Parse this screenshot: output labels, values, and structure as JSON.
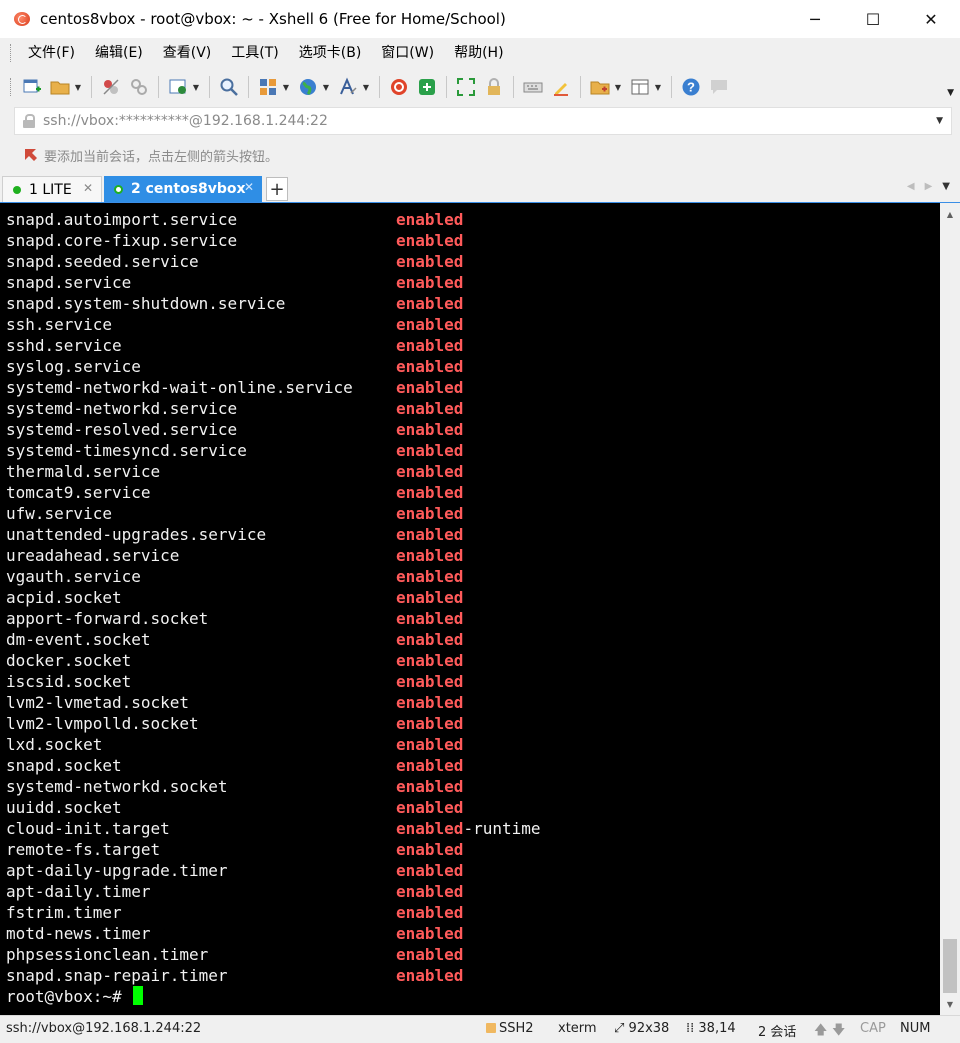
{
  "window": {
    "title": "centos8vbox - root@vbox: ~ - Xshell 6 (Free for Home/School)",
    "controls": {
      "minimize": "─",
      "maximize": "☐",
      "close": "✕"
    }
  },
  "menu": [
    "文件(F)",
    "编辑(E)",
    "查看(V)",
    "工具(T)",
    "选项卡(B)",
    "窗口(W)",
    "帮助(H)"
  ],
  "address": {
    "text": "ssh://vbox:**********@192.168.1.244:22"
  },
  "hint": {
    "text": "要添加当前会话，点击左侧的箭头按钮。"
  },
  "tabs": [
    {
      "label": "1 LITE",
      "active": false
    },
    {
      "label": "2 centos8vbox",
      "active": true
    }
  ],
  "terminal": {
    "lines": [
      {
        "unit": "snapd.autoimport.service",
        "state": "enabled"
      },
      {
        "unit": "snapd.core-fixup.service",
        "state": "enabled"
      },
      {
        "unit": "snapd.seeded.service",
        "state": "enabled"
      },
      {
        "unit": "snapd.service",
        "state": "enabled"
      },
      {
        "unit": "snapd.system-shutdown.service",
        "state": "enabled"
      },
      {
        "unit": "ssh.service",
        "state": "enabled"
      },
      {
        "unit": "sshd.service",
        "state": "enabled"
      },
      {
        "unit": "syslog.service",
        "state": "enabled"
      },
      {
        "unit": "systemd-networkd-wait-online.service",
        "state": "enabled"
      },
      {
        "unit": "systemd-networkd.service",
        "state": "enabled"
      },
      {
        "unit": "systemd-resolved.service",
        "state": "enabled"
      },
      {
        "unit": "systemd-timesyncd.service",
        "state": "enabled"
      },
      {
        "unit": "thermald.service",
        "state": "enabled"
      },
      {
        "unit": "tomcat9.service",
        "state": "enabled"
      },
      {
        "unit": "ufw.service",
        "state": "enabled"
      },
      {
        "unit": "unattended-upgrades.service",
        "state": "enabled"
      },
      {
        "unit": "ureadahead.service",
        "state": "enabled"
      },
      {
        "unit": "vgauth.service",
        "state": "enabled"
      },
      {
        "unit": "acpid.socket",
        "state": "enabled"
      },
      {
        "unit": "apport-forward.socket",
        "state": "enabled"
      },
      {
        "unit": "dm-event.socket",
        "state": "enabled"
      },
      {
        "unit": "docker.socket",
        "state": "enabled"
      },
      {
        "unit": "iscsid.socket",
        "state": "enabled"
      },
      {
        "unit": "lvm2-lvmetad.socket",
        "state": "enabled"
      },
      {
        "unit": "lvm2-lvmpolld.socket",
        "state": "enabled"
      },
      {
        "unit": "lxd.socket",
        "state": "enabled"
      },
      {
        "unit": "snapd.socket",
        "state": "enabled"
      },
      {
        "unit": "systemd-networkd.socket",
        "state": "enabled"
      },
      {
        "unit": "uuidd.socket",
        "state": "enabled"
      },
      {
        "unit": "cloud-init.target",
        "state": "enabled",
        "suffix": "-runtime"
      },
      {
        "unit": "remote-fs.target",
        "state": "enabled"
      },
      {
        "unit": "apt-daily-upgrade.timer",
        "state": "enabled"
      },
      {
        "unit": "apt-daily.timer",
        "state": "enabled"
      },
      {
        "unit": "fstrim.timer",
        "state": "enabled"
      },
      {
        "unit": "motd-news.timer",
        "state": "enabled"
      },
      {
        "unit": "phpsessionclean.timer",
        "state": "enabled"
      },
      {
        "unit": "snapd.snap-repair.timer",
        "state": "enabled"
      }
    ],
    "prompt": "root@vbox:~# "
  },
  "status": {
    "connection": "ssh://vbox@192.168.1.244:22",
    "protocol": "SSH2",
    "terminal_type": "xterm",
    "size": "92x38",
    "cursor_pos": "38,14",
    "sessions": "2 会话",
    "cap": "CAP",
    "num": "NUM"
  },
  "colors": {
    "terminal_bg": "#000000",
    "terminal_fg": "#f2f2f2",
    "enabled_red": "#ff5a5a",
    "cursor_green": "#00ff00",
    "tab_active": "#2f8ee5"
  }
}
